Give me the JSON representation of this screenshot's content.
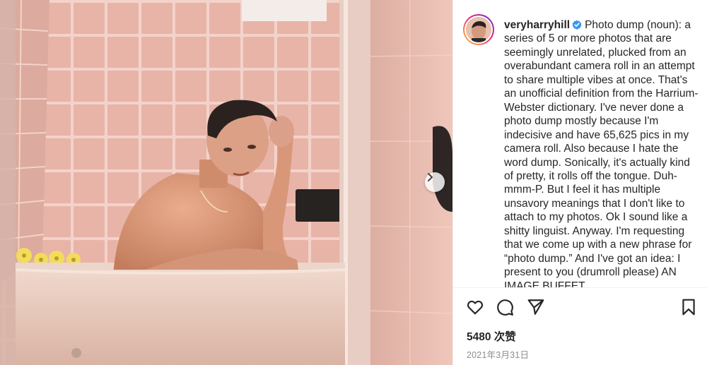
{
  "post": {
    "username": "veryharryhill",
    "caption": "Photo dump (noun): a series of 5 or more photos that are seemingly unrelated, plucked from an overabundant camera roll in an attempt to share multiple vibes at once. That's an unofficial definition from the Harrium-Webster dictionary. I've never done a photo dump mostly because I'm indecisive and have 65,625 pics in my camera roll. Also because I hate the word dump. Sonically, it's actually kind of pretty, it rolls off the tongue. Duh-mmm-P. But I feel it has multiple unsavory meanings that I don't like to attach to my photos. Ok I sound like a shitty linguist. Anyway. I'm requesting that we come up with a new phrase for “photo dump.” And I've got an idea: I present to you (drumroll please) AN IMAGE BUFFET",
    "likes": "5480 次赞",
    "date": "2021年3月31日"
  },
  "icons": {
    "verified": "verified-badge-icon",
    "carousel_next": "chevron-right-icon",
    "like": "heart-icon",
    "comment": "comment-icon",
    "share": "paper-plane-icon",
    "save": "bookmark-icon"
  },
  "colors": {
    "text": "#262626",
    "muted": "#8e8e8e",
    "verified": "#3897f0",
    "tile_pink": "#e6b1a6",
    "tub": "#e8c9bd"
  }
}
